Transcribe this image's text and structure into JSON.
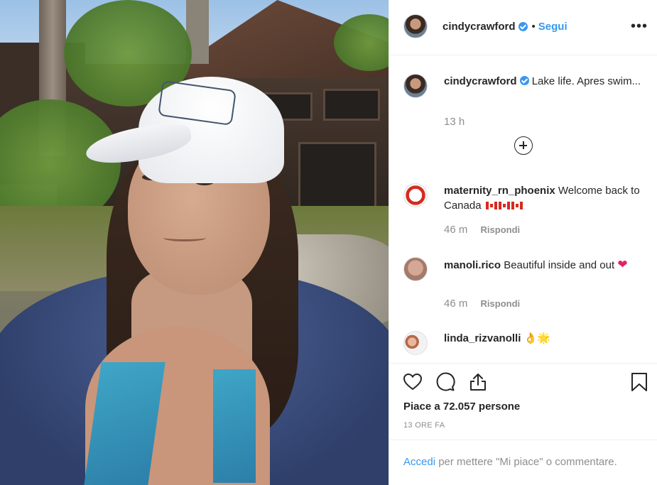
{
  "post": {
    "author": "cindycrawford",
    "follow_label": "Segui",
    "separator": "•",
    "more_label": "•••"
  },
  "caption": {
    "author": "cindycrawford",
    "text": "Lake life. Apres swim...",
    "time": "13 h"
  },
  "comments": [
    {
      "author": "maternity_rn_phoenix",
      "text": "Welcome back to Canada",
      "emoji": "🇨🇦🇨🇦🇨🇦",
      "time": "46 m",
      "reply_label": "Rispondi"
    },
    {
      "author": "manoli.rico",
      "text": "Beautiful inside and out",
      "emoji": "❤️",
      "time": "46 m",
      "reply_label": "Rispondi"
    },
    {
      "author": "linda_rizvanolli",
      "text": "👌🌟"
    }
  ],
  "actions": {
    "likes_text": "Piace a 72.057 persone",
    "posted_ago": "13 ORE FA"
  },
  "footer": {
    "login_label": "Accedi",
    "login_suffix": "per mettere \"Mi piace\" o commentare."
  },
  "icons": [
    "heart-icon",
    "comment-icon",
    "share-icon",
    "bookmark-icon",
    "add-comment-icon",
    "verified-badge-icon"
  ],
  "colors": {
    "link_blue": "#3897f0",
    "text": "#262626",
    "muted": "#8e8e8e",
    "border": "#efefef"
  }
}
